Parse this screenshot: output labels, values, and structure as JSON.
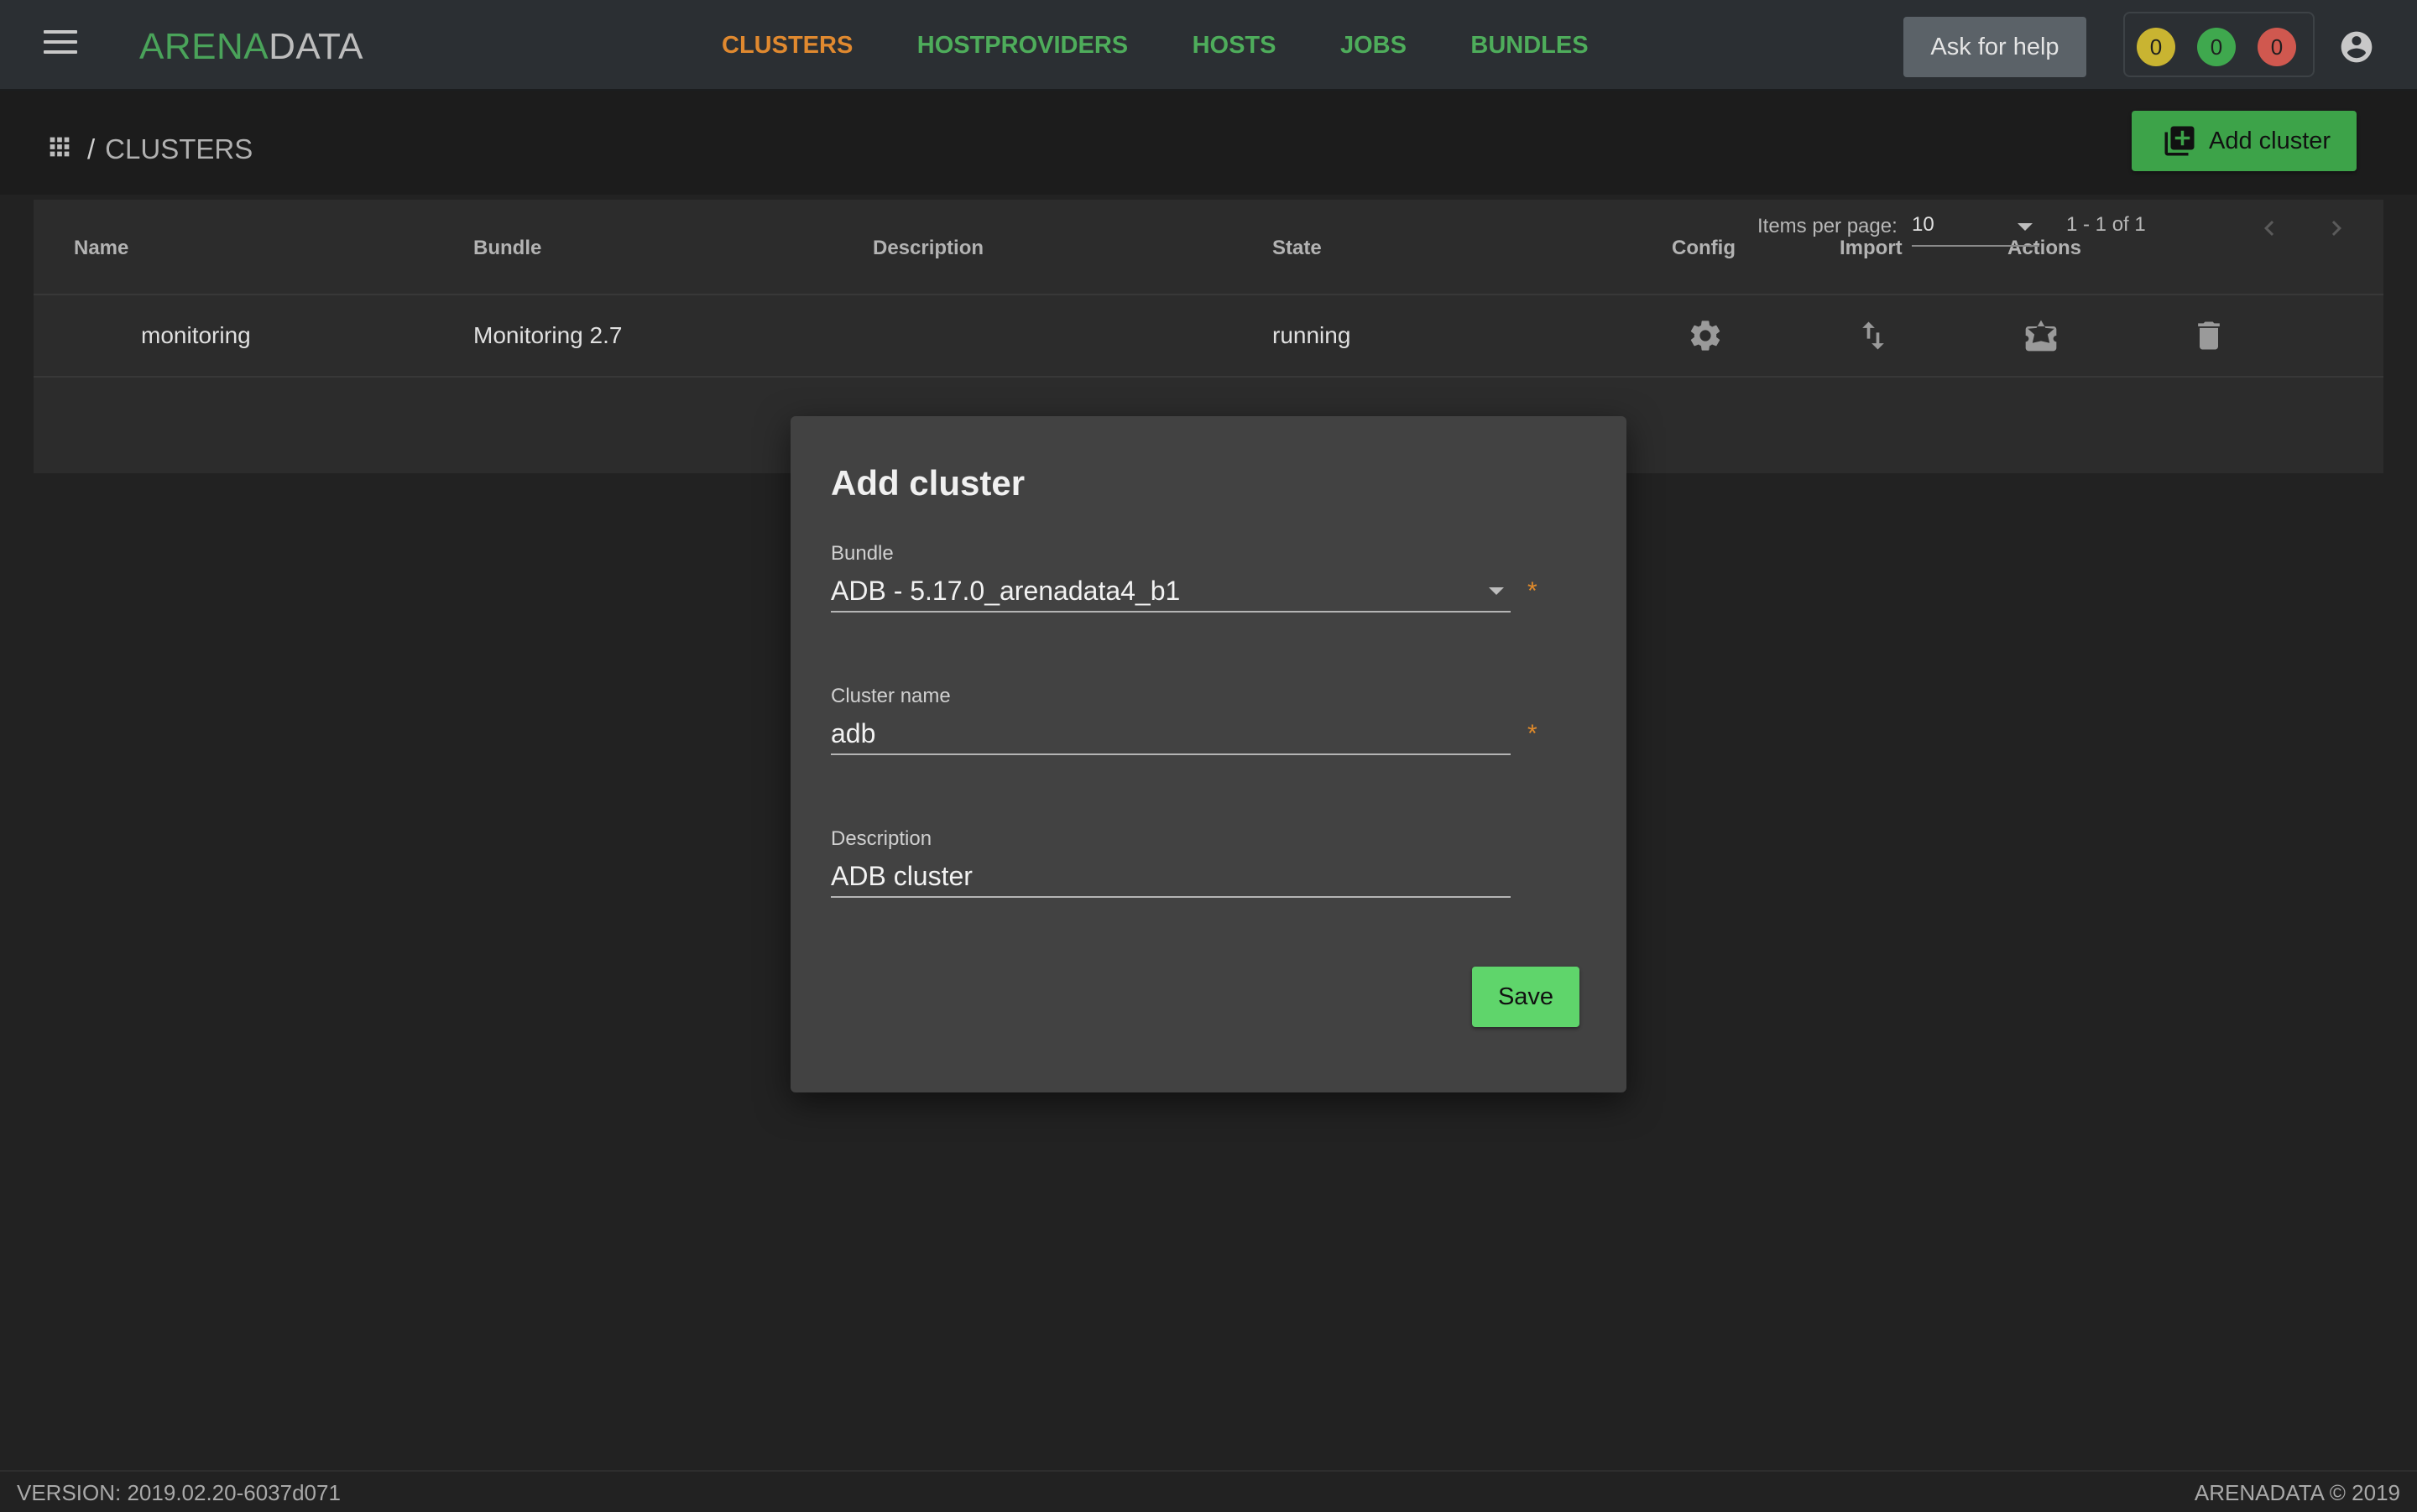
{
  "header": {
    "logo_part1": "ARENA",
    "logo_part2": "DATA",
    "nav": [
      "CLUSTERS",
      "HOSTPROVIDERS",
      "HOSTS",
      "JOBS",
      "BUNDLES"
    ],
    "active_nav": "CLUSTERS",
    "help_label": "Ask for help",
    "badges": {
      "warning": "0",
      "success": "0",
      "failed": "0"
    }
  },
  "breadcrumb": {
    "separator": "/",
    "current": "CLUSTERS"
  },
  "add_cluster_label": "Add cluster",
  "table": {
    "columns": [
      "Name",
      "Bundle",
      "Description",
      "State",
      "Config",
      "Import",
      "Actions"
    ],
    "rows": [
      {
        "name": "monitoring",
        "bundle": "Monitoring 2.7",
        "description": "",
        "state": "running"
      }
    ],
    "paginator": {
      "label": "Items per page:",
      "page_size": "10",
      "range": "1 - 1 of 1"
    }
  },
  "dialog": {
    "title": "Add cluster",
    "bundle_label": "Bundle",
    "bundle_value": "ADB - 5.17.0_arenadata4_b1",
    "cluster_name_label": "Cluster name",
    "cluster_name_value": "adb",
    "description_label": "Description",
    "description_value": "ADB cluster",
    "required_mark": "*",
    "save_label": "Save"
  },
  "footer": {
    "version": "VERSION: 2019.02.20-6037d071",
    "copyright": "ARENADATA © 2019"
  },
  "colors": {
    "accent_green": "#4ead5b",
    "active_orange": "#e0892f",
    "badge_yellow": "#c9b431",
    "badge_green": "#3fa84e",
    "badge_red": "#d0584f"
  }
}
